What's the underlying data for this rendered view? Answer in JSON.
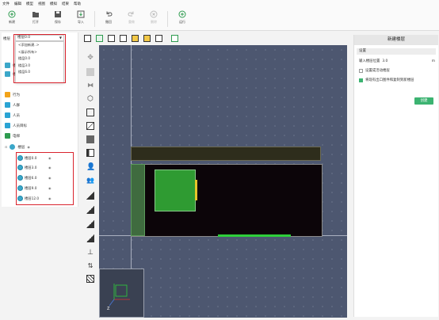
{
  "menu": [
    "文件",
    "编辑",
    "模型",
    "视图",
    "模拟",
    "结果",
    "帮助"
  ],
  "toolbar": {
    "new": "新建",
    "open": "打开",
    "save": "保存",
    "import": "导入",
    "undo": "撤回",
    "redo": "重做",
    "delete": "删除",
    "run": "运行"
  },
  "model": {
    "label": "楼层",
    "selected": "楼层0.0",
    "options": [
      "<添加新建..>",
      "<展示所有>",
      "楼层0.0",
      "楼层3.0",
      "楼层6.0"
    ]
  },
  "tree": {
    "items": [
      "楼层3.0",
      "楼层6.0",
      "行为",
      "人群",
      "人员",
      "人员目标",
      "电梯",
      "楼层"
    ],
    "sub_items": [
      "楼层0.0",
      "楼层3.0",
      "楼层6.0",
      "楼层9.0",
      "楼层12.0"
    ]
  },
  "right_panel": {
    "title": "新建楼层",
    "section": "设置",
    "input_label": "输入楼层位置",
    "input_value": "3.0",
    "input_unit": "m",
    "option1": "设置成活动楼层",
    "option2": "将现有出口图件和复制到新楼层",
    "create_button": "创建"
  },
  "minimap": {
    "axis_label": "Z"
  },
  "colors": {
    "accent": "#3cb371",
    "highlight": "#d9232d",
    "canvas": "#4d5770"
  }
}
